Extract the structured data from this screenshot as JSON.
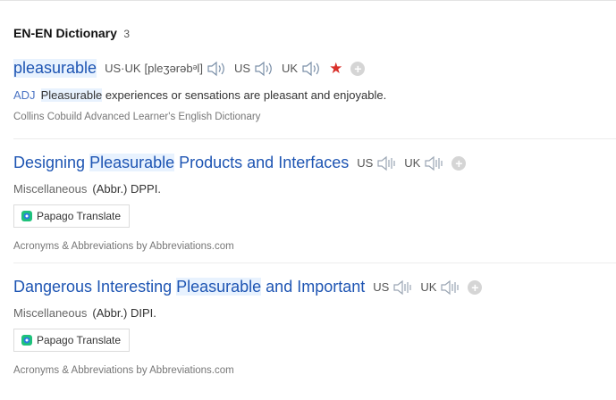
{
  "section": {
    "title": "EN-EN Dictionary",
    "count": "3"
  },
  "entry1": {
    "headword": "pleasurable",
    "pron_label": "US·UK",
    "ipa": "[pleʒərəbᵊl]",
    "us_label": "US",
    "uk_label": "UK",
    "star": "★",
    "add": "+",
    "pos": "ADJ",
    "def_highlight": "Pleasurable",
    "def_rest": " experiences or sensations are pleasant and enjoyable.",
    "source": "Collins Cobuild Advanced Learner's English Dictionary"
  },
  "entry2": {
    "title_pre": "Designing ",
    "title_hl": "Pleasurable",
    "title_post": " Products and Interfaces",
    "us_label": "US",
    "uk_label": "UK",
    "add": "+",
    "category": "Miscellaneous",
    "abbr": "(Abbr.) DPPI.",
    "translate_label": "Papago Translate",
    "source": "Acronyms & Abbreviations by Abbreviations.com"
  },
  "entry3": {
    "title_pre": "Dangerous Interesting ",
    "title_hl": "Pleasurable",
    "title_post": " and Important",
    "us_label": "US",
    "uk_label": "UK",
    "add": "+",
    "category": "Miscellaneous",
    "abbr": "(Abbr.) DIPI.",
    "translate_label": "Papago Translate",
    "source": "Acronyms & Abbreviations by Abbreviations.com"
  },
  "colors": {
    "link": "#1e55b3",
    "highlight": "#e8f2fe",
    "star": "#d9302a",
    "pos": "#4d75c4"
  },
  "icons": {
    "speaker_filled": "speaker-icon",
    "speaker_disabled": "speaker-disabled-icon",
    "papago": "papago-logo-icon"
  }
}
